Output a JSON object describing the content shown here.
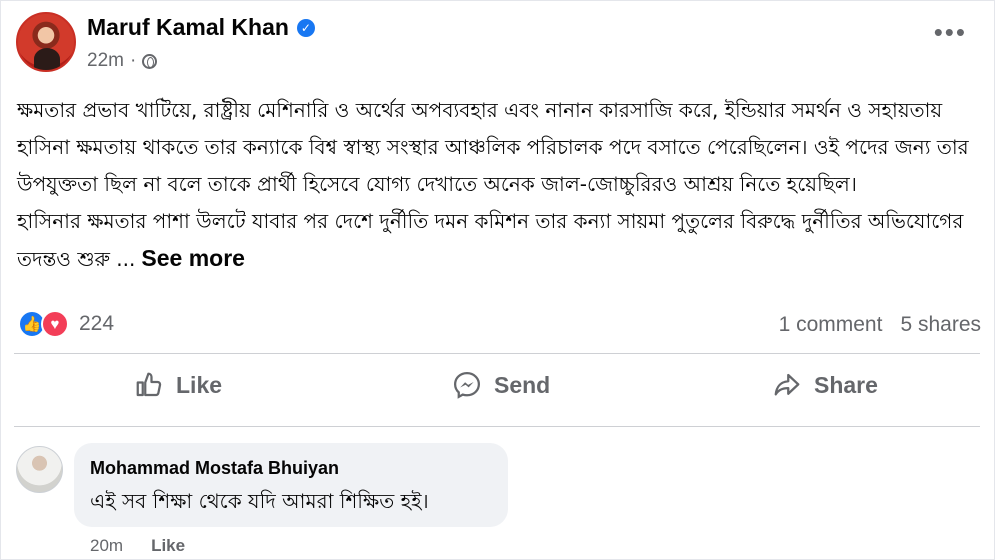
{
  "post": {
    "author": "Maruf Kamal Khan",
    "time": "22m",
    "paragraph1": "ক্ষমতার প্রভাব খাটিয়ে, রাষ্ট্রীয় মেশিনারি ও অর্থের অপব্যবহার এবং নানান কারসাজি করে, ইন্ডিয়ার সমর্থন ও সহায়তায় হাসিনা ক্ষমতায় থাকতে তার কন্যাকে বিশ্ব স্বাস্থ্য সংস্থার আঞ্চলিক পরিচালক পদে বসাতে পেরেছিলেন। ওই পদের জন্য তার উপযুক্ততা ছিল না বলে তাকে প্রার্থী হিসেবে যোগ্য দেখাতে অনেক জাল-জোচ্চুরিরও আশ্রয় নিতে হয়েছিল।",
    "paragraph2": "হাসিনার ক্ষমতার পাশা উলটে যাবার পর দেশে দুর্নীতি দমন কমিশন তার কন্যা সায়মা পুতুলের বিরুদ্ধে দুর্নীতির অভিযোগের তদন্তও শুরু ...",
    "see_more": "See more"
  },
  "stats": {
    "reaction_count": "224",
    "comments": "1 comment",
    "shares": "5 shares"
  },
  "actions": {
    "like": "Like",
    "send": "Send",
    "share": "Share"
  },
  "comment": {
    "author": "Mohammad Mostafa Bhuiyan",
    "text": "এই সব শিক্ষা থেকে যদি আমরা শিক্ষিত হই।",
    "time": "20m",
    "like": "Like"
  },
  "icons": {
    "verified": "verified-badge-icon",
    "privacy": "globe-icon",
    "menu": "more-options-icon",
    "reaction_like": "like-reaction-icon",
    "reaction_love": "love-reaction-icon",
    "like_action": "thumbs-up-icon",
    "send_action": "messenger-icon",
    "share_action": "share-arrow-icon"
  },
  "colors": {
    "accent": "#1877f2",
    "love": "#f33e58",
    "secondary_text": "#65676b"
  }
}
